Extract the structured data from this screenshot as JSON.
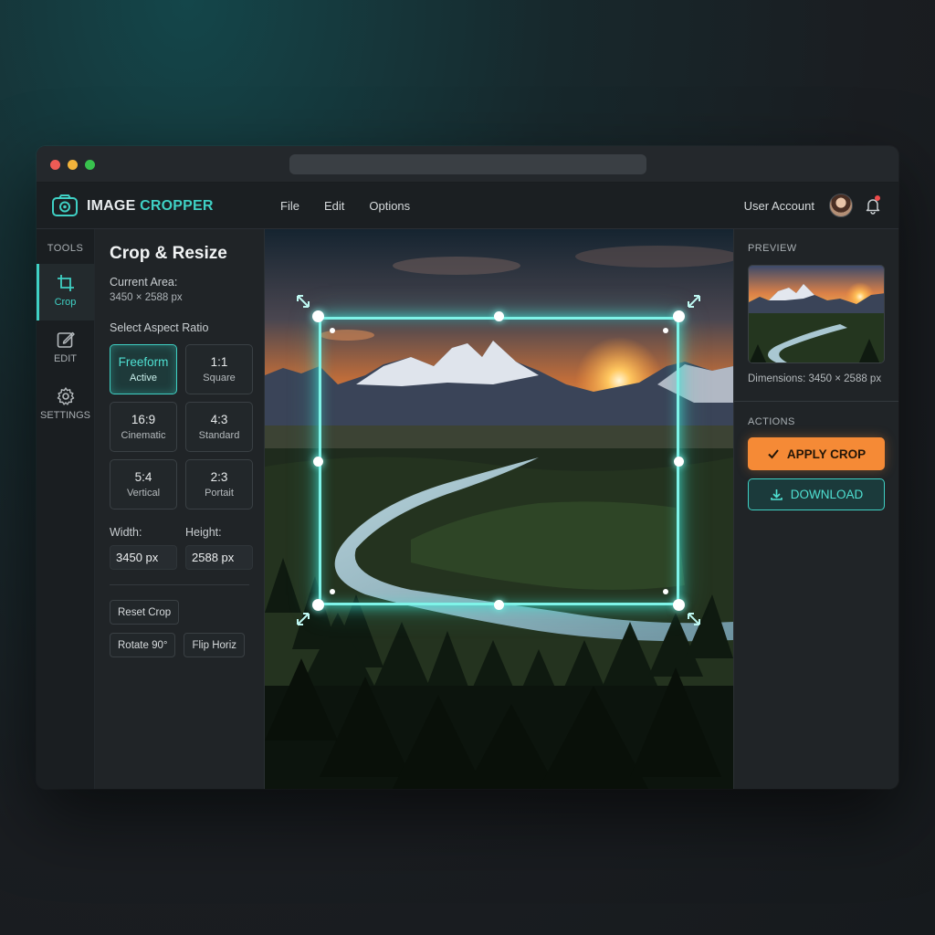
{
  "app": {
    "title_white": "IMAGE ",
    "title_accent": "CROPPER"
  },
  "menu": [
    "File",
    "Edit",
    "Options"
  ],
  "account": {
    "label": "User Account"
  },
  "rail": {
    "header": "TOOLS",
    "items": [
      {
        "label": "Crop",
        "icon": "crop-icon",
        "active": true
      },
      {
        "label": "EDIT",
        "icon": "edit-icon"
      },
      {
        "label": "SETTINGS",
        "icon": "gear-icon"
      }
    ]
  },
  "tools": {
    "title": "Crop & Resize",
    "current_area_label": "Current Area:",
    "current_area_value": "3450 × 2588 px",
    "aspect_label": "Select Aspect Ratio",
    "ratios": [
      {
        "main": "Freeform",
        "sub": "Active",
        "active": true
      },
      {
        "main": "1:1",
        "sub": "Square"
      },
      {
        "main": "16:9",
        "sub": "Cinematic"
      },
      {
        "main": "4:3",
        "sub": "Standard"
      },
      {
        "main": "5:4",
        "sub": "Vertical"
      },
      {
        "main": "2:3",
        "sub": "Portait"
      }
    ],
    "width_label": "Width:",
    "width_value": "3450 px",
    "height_label": "Height:",
    "height_value": "2588 px",
    "reset_label": "Reset Crop",
    "rotate_label": "Rotate 90°",
    "flip_label": "Flip Horiz"
  },
  "right": {
    "preview_label": "PREVIEW",
    "dimensions": "Dimensions: 3450 × 2588 px",
    "actions_label": "ACTIONS",
    "apply_label": "APPLY CROP",
    "download_label": "DOWNLOAD"
  },
  "colors": {
    "accent": "#3fd0c4",
    "apply": "#f58a36",
    "notification": "#ef4b4b"
  }
}
